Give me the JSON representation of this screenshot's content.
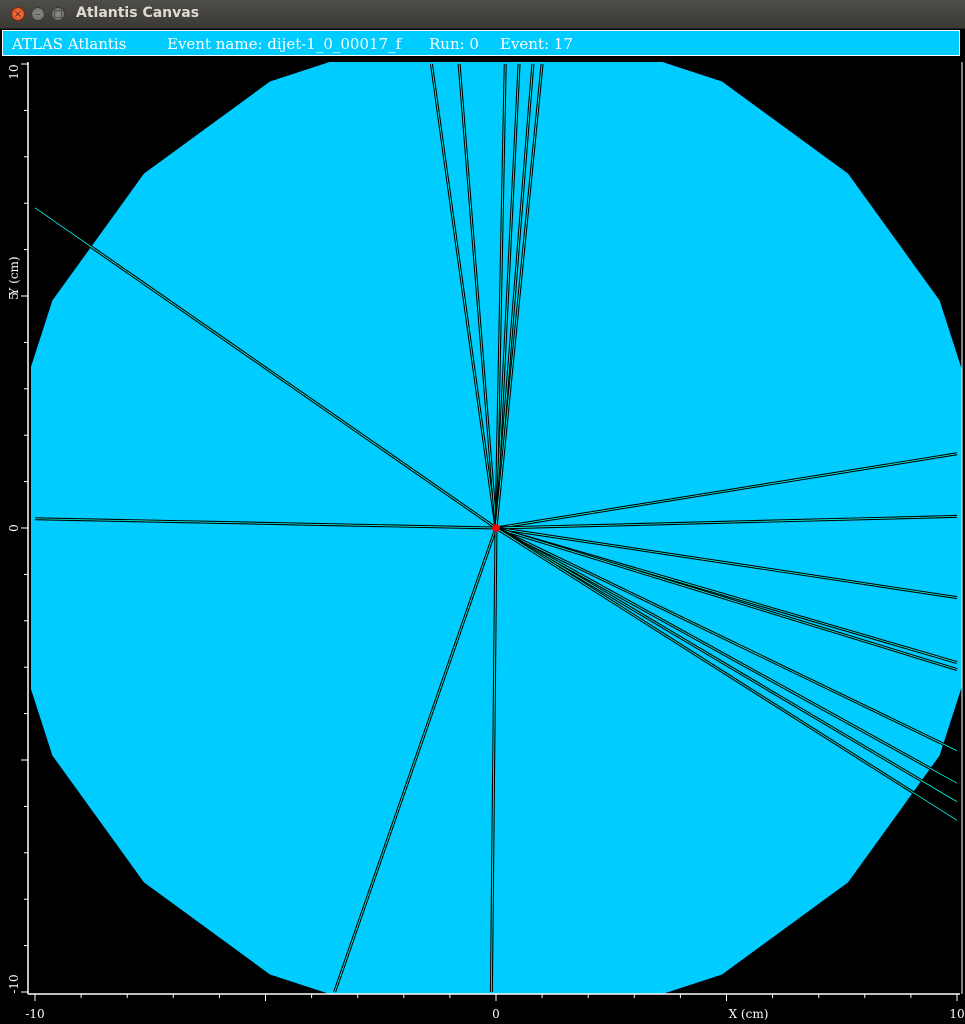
{
  "window": {
    "title": "Atlantis Canvas",
    "close_glyph": "×",
    "min_glyph": "–",
    "max_glyph": "□"
  },
  "infobar": {
    "app_name": "ATLAS Atlantis",
    "event_name": "Event name: dijet-1_0_00017_f",
    "run": "Run: 0",
    "event": "Event: 17"
  },
  "colors": {
    "background": "#000000",
    "detector_fill": "#00ccff",
    "track_outline": "#000000",
    "track_highlight": "#00ffee",
    "vertex": "#ff0000",
    "axis": "#ffffff"
  },
  "chart_data": {
    "type": "scatter",
    "title": "",
    "xlabel": "X (cm)",
    "ylabel": "Y (cm)",
    "xlim": [
      -10,
      10
    ],
    "ylim": [
      -10,
      10
    ],
    "x_tick_labels": [
      "-10",
      "0",
      "10"
    ],
    "y_tick_labels": [
      "10",
      "5",
      "0",
      "-10"
    ],
    "x_ticks": [
      -10,
      0,
      10
    ],
    "y_ticks": [
      10,
      5,
      0,
      -10
    ],
    "detector_shape": "regular 20-sided polygon centered on origin",
    "detector_radius_cm": 10.8,
    "vertex": [
      0,
      0
    ],
    "tracks": [
      {
        "x": -1.4,
        "y": 10
      },
      {
        "x": -0.8,
        "y": 10
      },
      {
        "x": 0.2,
        "y": 10
      },
      {
        "x": 0.5,
        "y": 10
      },
      {
        "x": 0.8,
        "y": 10
      },
      {
        "x": 1.0,
        "y": 10
      },
      {
        "x": -10,
        "y": 6.9
      },
      {
        "x": -10,
        "y": 0.2
      },
      {
        "x": 10,
        "y": 1.6
      },
      {
        "x": 10,
        "y": 0.25
      },
      {
        "x": 10,
        "y": -1.5
      },
      {
        "x": 10,
        "y": -2.9
      },
      {
        "x": 10,
        "y": -3.05
      },
      {
        "x": 10,
        "y": -4.8
      },
      {
        "x": 10,
        "y": -5.5
      },
      {
        "x": 10,
        "y": -5.9
      },
      {
        "x": 10,
        "y": -6.3
      },
      {
        "x": -3.5,
        "y": -10
      },
      {
        "x": -0.1,
        "y": -10
      }
    ]
  }
}
